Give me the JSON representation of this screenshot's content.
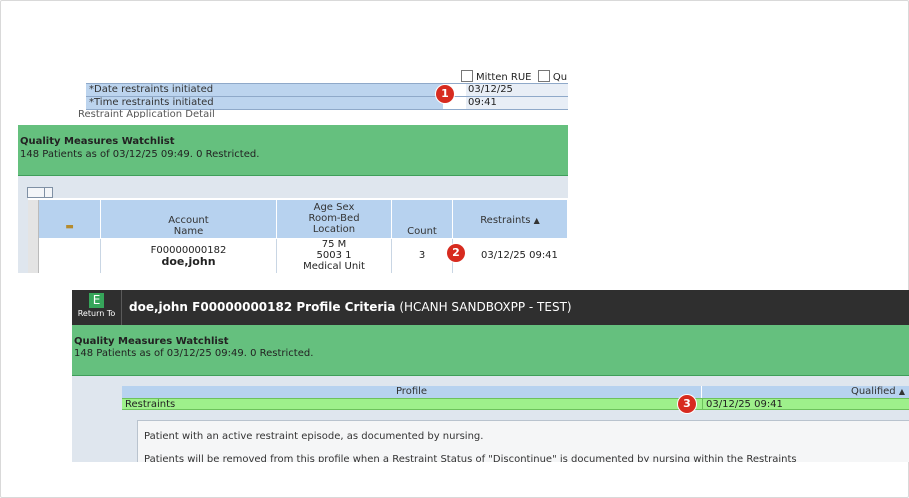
{
  "panel1": {
    "checkboxes": [
      {
        "label": "Mitten RUE"
      },
      {
        "label": "Qu"
      }
    ],
    "rows": [
      {
        "label": "*Date restraints initiated",
        "value": "03/12/25"
      },
      {
        "label": "*Time restraints initiated",
        "value": "09:41"
      }
    ],
    "cut_text": "Restraint Application Detail",
    "marker": "1"
  },
  "panel2": {
    "title": "Quality Measures Watchlist",
    "subtitle": "148 Patients as of 03/12/25 09:49. 0 Restricted.",
    "columns": {
      "account": [
        "Account",
        "Name"
      ],
      "demo": [
        "Age Sex",
        "Room-Bed",
        "Location"
      ],
      "count": "Count",
      "restraints": "Restraints",
      "sort_arrow": "▲"
    },
    "row": {
      "account": "F00000000182",
      "name": "doe,john",
      "age_sex": "75 M",
      "room_bed": "5003 1",
      "location": "Medical Unit",
      "count": "3",
      "restraints": "03/12/25 09:41"
    },
    "marker": "2"
  },
  "panel3": {
    "return_icon": "E",
    "return_label": "Return To",
    "title_bold": "doe,john F00000000182 Profile Criteria",
    "title_env": "(HCANH SANDBOXPP - TEST)",
    "list_title": "Quality Measures Watchlist",
    "list_subtitle": "148 Patients as of 03/12/25 09:49. 0 Restricted.",
    "col_profile": "Profile",
    "col_qualified": "Qualified",
    "sort_arrow": "▲",
    "profile_name": "Restraints",
    "qualified_value": "03/12/25 09:41",
    "desc_line1": "Patient with an active restraint episode, as documented by nursing.",
    "desc_line2": "Patients will be removed from this profile when a Restraint Status of \"Discontinue\" is documented by nursing within the Restraints",
    "marker": "3"
  },
  "colors": {
    "header_green": "#65c07e",
    "marker_red": "#d72b1f",
    "row_green": "#9ef08b",
    "col_blue": "#b7d2ef"
  }
}
